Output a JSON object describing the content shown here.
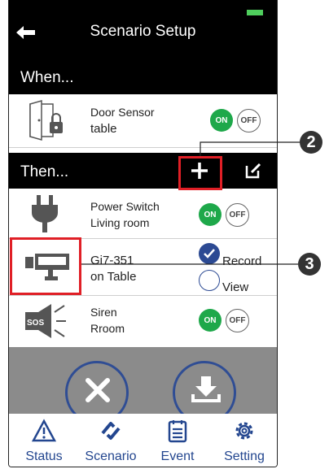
{
  "header": {
    "title": "Scenario Setup"
  },
  "when_section": {
    "label": "When..."
  },
  "when_items": [
    {
      "name": "Door Sensor",
      "location": "table",
      "on_label": "ON",
      "off_label": "OFF"
    }
  ],
  "then_section": {
    "label": "Then..."
  },
  "then_items": {
    "power": {
      "name": "Power Switch",
      "location": "Living room",
      "on_label": "ON",
      "off_label": "OFF"
    },
    "camera": {
      "name": "Gi7-351",
      "location": "on Table",
      "option_record": "Record",
      "option_view": "View",
      "selected": "Record"
    },
    "siren": {
      "name": "Siren",
      "location": "Rroom",
      "icon_text": "SOS",
      "on_label": "ON",
      "off_label": "OFF"
    }
  },
  "tabs": [
    {
      "label": "Status",
      "icon": "warning-icon"
    },
    {
      "label": "Scenario",
      "icon": "scenario-icon"
    },
    {
      "label": "Event",
      "icon": "event-list-icon"
    },
    {
      "label": "Setting",
      "icon": "gear-icon"
    }
  ],
  "callouts": {
    "add": "2",
    "camera": "3"
  },
  "colors": {
    "on": "#1ea84a",
    "brand_blue": "#23468f",
    "highlight": "#e01f26",
    "battery": "#4fce5d"
  }
}
